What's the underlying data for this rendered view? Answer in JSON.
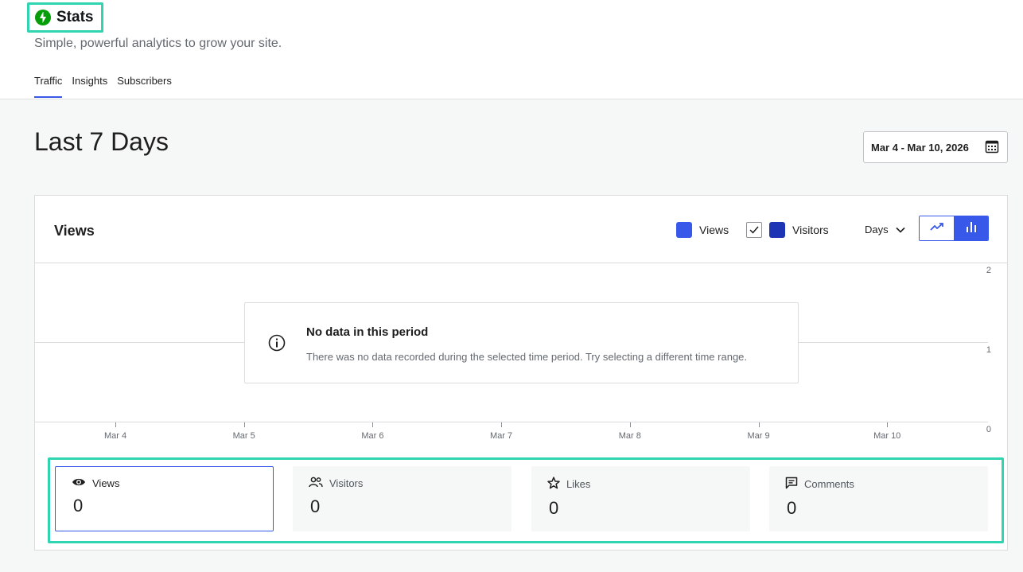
{
  "header": {
    "title": "Stats",
    "subtitle": "Simple, powerful analytics to grow your site.",
    "tabs": [
      {
        "label": "Traffic",
        "active": true
      },
      {
        "label": "Insights",
        "active": false
      },
      {
        "label": "Subscribers",
        "active": false
      }
    ]
  },
  "page": {
    "title": "Last 7 Days",
    "date_range": "Mar 4 - Mar 10, 2026"
  },
  "chart_card": {
    "title": "Views",
    "legend": [
      {
        "label": "Views",
        "color": "#3858e9",
        "has_checkbox": false
      },
      {
        "label": "Visitors",
        "color": "#1d35b4",
        "has_checkbox": true,
        "checked": true
      }
    ],
    "interval": "Days",
    "chart_type_options": [
      "line-chart-icon",
      "bar-chart-icon"
    ],
    "selected_chart_type": "bar"
  },
  "chart_data": {
    "type": "bar",
    "categories": [
      "Mar 4",
      "Mar 5",
      "Mar 6",
      "Mar 7",
      "Mar 8",
      "Mar 9",
      "Mar 10"
    ],
    "series": [
      {
        "name": "Views",
        "values": [
          0,
          0,
          0,
          0,
          0,
          0,
          0
        ]
      },
      {
        "name": "Visitors",
        "values": [
          0,
          0,
          0,
          0,
          0,
          0,
          0
        ]
      }
    ],
    "yticks": [
      "2",
      "1",
      "0"
    ],
    "ylim": [
      0,
      2
    ],
    "grid": true
  },
  "notice": {
    "title": "No data in this period",
    "text": "There was no data recorded during the selected time period. Try selecting a different time range."
  },
  "stats": [
    {
      "label": "Views",
      "value": "0",
      "icon": "eye-icon",
      "active": true
    },
    {
      "label": "Visitors",
      "value": "0",
      "icon": "people-icon",
      "active": false
    },
    {
      "label": "Likes",
      "value": "0",
      "icon": "star-icon",
      "active": false
    },
    {
      "label": "Comments",
      "value": "0",
      "icon": "comment-icon",
      "active": false
    }
  ],
  "colors": {
    "accent": "#3858e9",
    "brand": "#069e08",
    "highlight": "#2fd4b0"
  }
}
